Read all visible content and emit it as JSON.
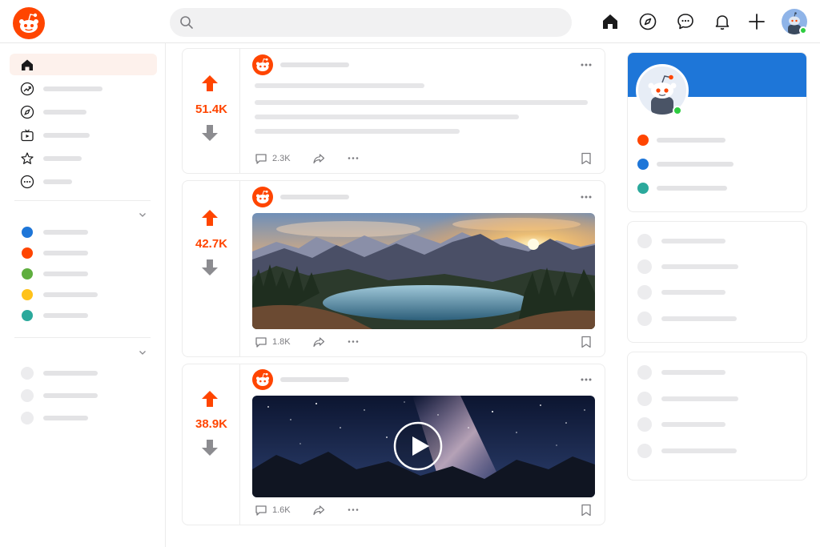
{
  "app": {
    "name": "Reddit",
    "logo_icon": "reddit-snoo-icon",
    "brand_color": "#ff4500",
    "accent_blue": "#1e76d8"
  },
  "search": {
    "value": "",
    "placeholder": "",
    "icon": "search-icon"
  },
  "top_nav": {
    "icons": [
      "home-icon",
      "explore-compass-icon",
      "chat-icon",
      "notifications-bell-icon",
      "create-plus-icon"
    ],
    "user_avatar": "user-avatar",
    "online_status_color": "#2ecc40"
  },
  "sidebar": {
    "primary_items": [
      {
        "icon": "home-icon",
        "active": true
      },
      {
        "icon": "popular-trending-icon",
        "active": false
      },
      {
        "icon": "explore-compass-icon",
        "active": false
      },
      {
        "icon": "watch-tv-icon",
        "active": false
      },
      {
        "icon": "favorites-star-icon",
        "active": false
      },
      {
        "icon": "more-circle-icon",
        "active": false
      }
    ],
    "communities": [
      {
        "color": "#1e76d8"
      },
      {
        "color": "#ff4500"
      },
      {
        "color": "#5fae3e"
      },
      {
        "color": "#ffc21a"
      },
      {
        "color": "#2ba99c"
      }
    ]
  },
  "feed": {
    "posts": [
      {
        "votes": "51.4K",
        "comments": "2.3K",
        "type": "text"
      },
      {
        "votes": "42.7K",
        "comments": "1.8K",
        "type": "image"
      },
      {
        "votes": "38.9K",
        "comments": "1.6K",
        "type": "video"
      }
    ]
  },
  "right_sidebar": {
    "profile_list_colors": [
      "#ff4500",
      "#1e76d8",
      "#2ba99c"
    ]
  }
}
